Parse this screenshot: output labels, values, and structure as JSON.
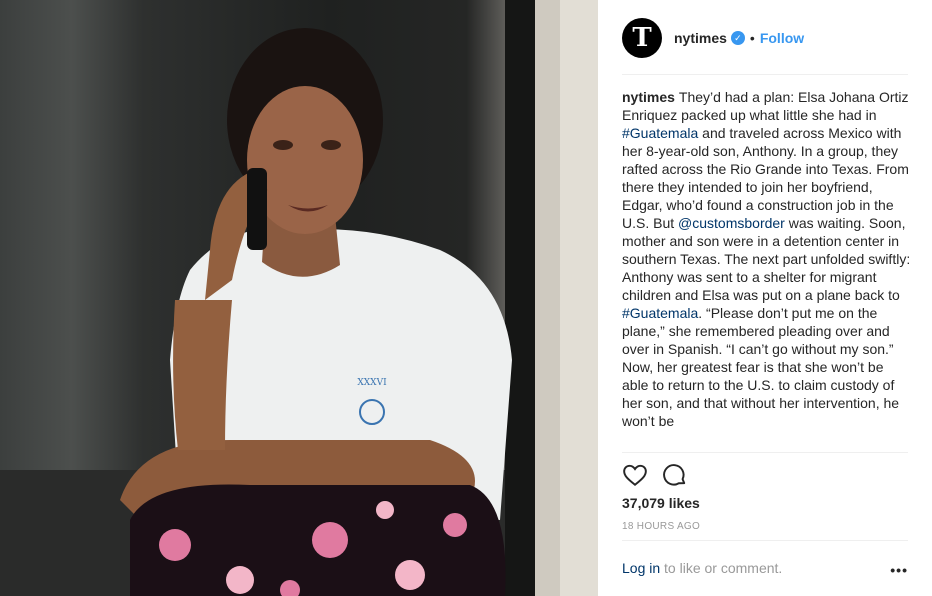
{
  "post": {
    "username": "nytimes",
    "avatar_letter": "T",
    "separator": "•",
    "follow_label": "Follow",
    "caption_author": "nytimes",
    "caption_parts": [
      "They’d had a plan: Elsa Johana Ortiz Enriquez packed up what little she had in ",
      "#Guatemala",
      " and traveled across Mexico with her 8-year-old son, Anthony. In a group, they rafted across the Rio Grande into Texas. From there they intended to join her boyfriend, Edgar, who’d found a construction job in the U.S. But ",
      "@customsborder",
      " was waiting. Soon, mother and son were in a detention center in southern Texas. The next part unfolded swiftly: Anthony was sent to a shelter for migrant children and Elsa was put on a plane back to ",
      "#Guatemala",
      ". “Please don’t put me on the plane,” she remembered pleading over and over in Spanish. “I can’t go without my son.” Now, her greatest fear is that she won’t be able to return to the U.S. to claim custody of her son, and that without her intervention, he won’t be"
    ],
    "likes": "37,079 likes",
    "time_ago": "18 HOURS AGO",
    "login_link": "Log in",
    "login_suffix": " to like or comment.",
    "more_label": "•••"
  },
  "icons": {
    "verified": "verified-badge-icon",
    "like": "heart-icon",
    "comment": "comment-icon",
    "more": "more-options-icon"
  },
  "colors": {
    "link": "#003569",
    "accent": "#3897f0",
    "muted": "#999999",
    "text": "#262626"
  }
}
